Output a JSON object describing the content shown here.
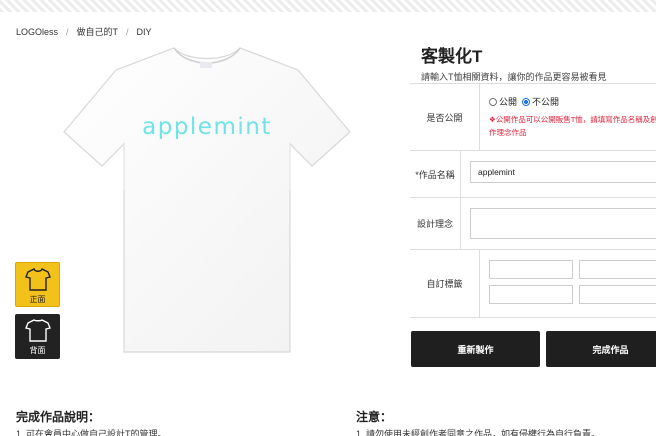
{
  "breadcrumb": [
    "LOGOless",
    "做自己的T",
    "DIY"
  ],
  "product": {
    "print_text": "applemint",
    "print_color": "#6fe3e6",
    "shirt_color": "#ffffff"
  },
  "thumbs": {
    "front_label": "正面",
    "back_label": "背面",
    "front_bg": "#f2c21a",
    "back_bg": "#222222"
  },
  "panel": {
    "title": "客製化T",
    "subtitle": "請輸入T恤相關資料，讓你的作品更容易被看見",
    "public_label": "是否公開",
    "option_public": "公開",
    "option_private": "不公開",
    "selected_option": "不公開",
    "public_warning": "❖公開作品可以公開販售T恤，請填寫作品名稱及創作理念作品",
    "name_label": "*作品名稱",
    "name_value": "applemint",
    "concept_label": "設計理念",
    "tags_label": "自訂標籤"
  },
  "buttons": {
    "reset": "重新製作",
    "finish": "完成作品"
  },
  "sections": {
    "left_title": "完成作品說明：",
    "left_line": "1. 可在會員中心做自己設計T的管理。",
    "right_title": "注意：",
    "right_line": "1. 請勿使用未經創作者同意之作品，如有侵權行為自行負責。"
  }
}
